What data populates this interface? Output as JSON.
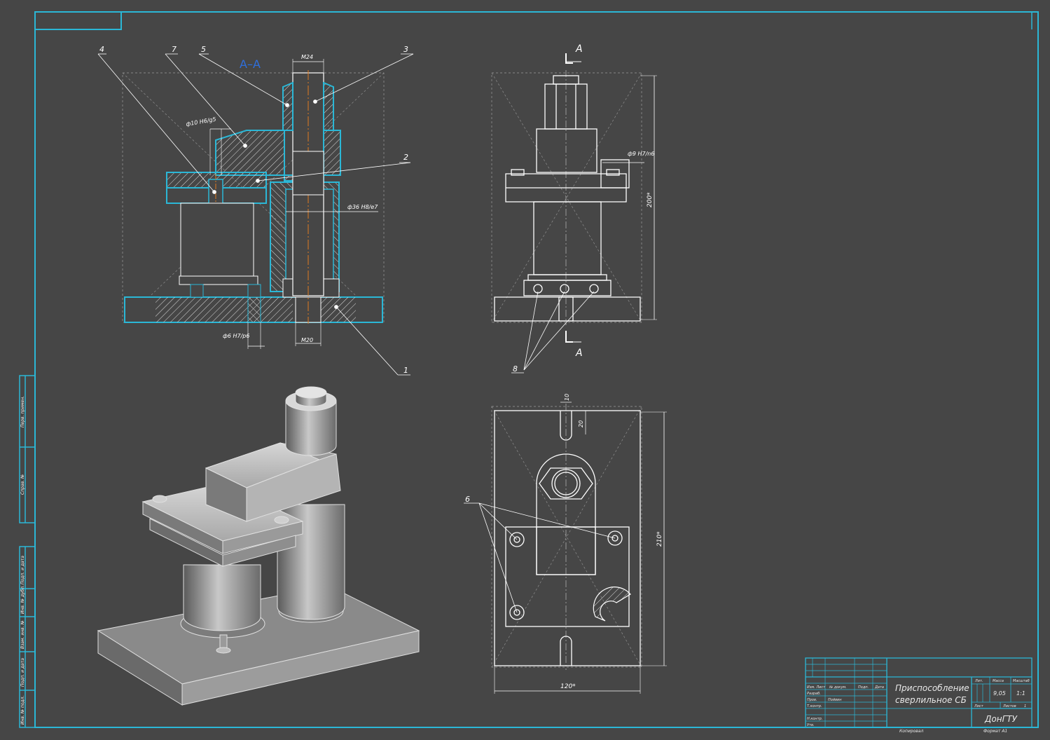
{
  "section_title": "А–А",
  "callouts": {
    "c1": "1",
    "c2": "2",
    "c3": "3",
    "c4": "4",
    "c5": "5",
    "c6": "6",
    "c7": "7",
    "c8": "8"
  },
  "dims": {
    "m24": "М24",
    "m20": "М20",
    "fit10": "ф10 H6/g5",
    "fit6": "ф6 H7/p6",
    "fit36": "ф36 H8/e7",
    "fit9": "ф9 H7/n6",
    "h200": "200*",
    "h210": "210*",
    "w120": "120*",
    "slot10": "10",
    "slot20": "20"
  },
  "section_marks": {
    "top": "А",
    "bottom": "А"
  },
  "side_stamps": [
    "Перв. примен.",
    "Справ. №",
    "Подп. и дата",
    "Инв. № дубл.",
    "Взам. инв. №",
    "Подп. и дата",
    "Инв. № подл."
  ],
  "title_block": {
    "title_line1": "Приспособление",
    "title_line2": "сверлильное СБ",
    "org": "ДонГТУ",
    "mass": "9,05",
    "scale": "1:1",
    "lit_label": "Лит.",
    "mass_label": "Масса",
    "scale_label": "Масштаб",
    "sheet_label": "Лист",
    "sheets_label": "Листов",
    "sheets_value": "1",
    "rows": [
      "Изм. Лист",
      "Разраб.",
      "Пров.",
      "Т.контр.",
      "Н.контр.",
      "Утв."
    ],
    "cols": [
      "№ докум.",
      "Подп.",
      "Дата"
    ],
    "checker": "Пойвин",
    "copied": "Копировал",
    "format": "Формат  А1"
  }
}
